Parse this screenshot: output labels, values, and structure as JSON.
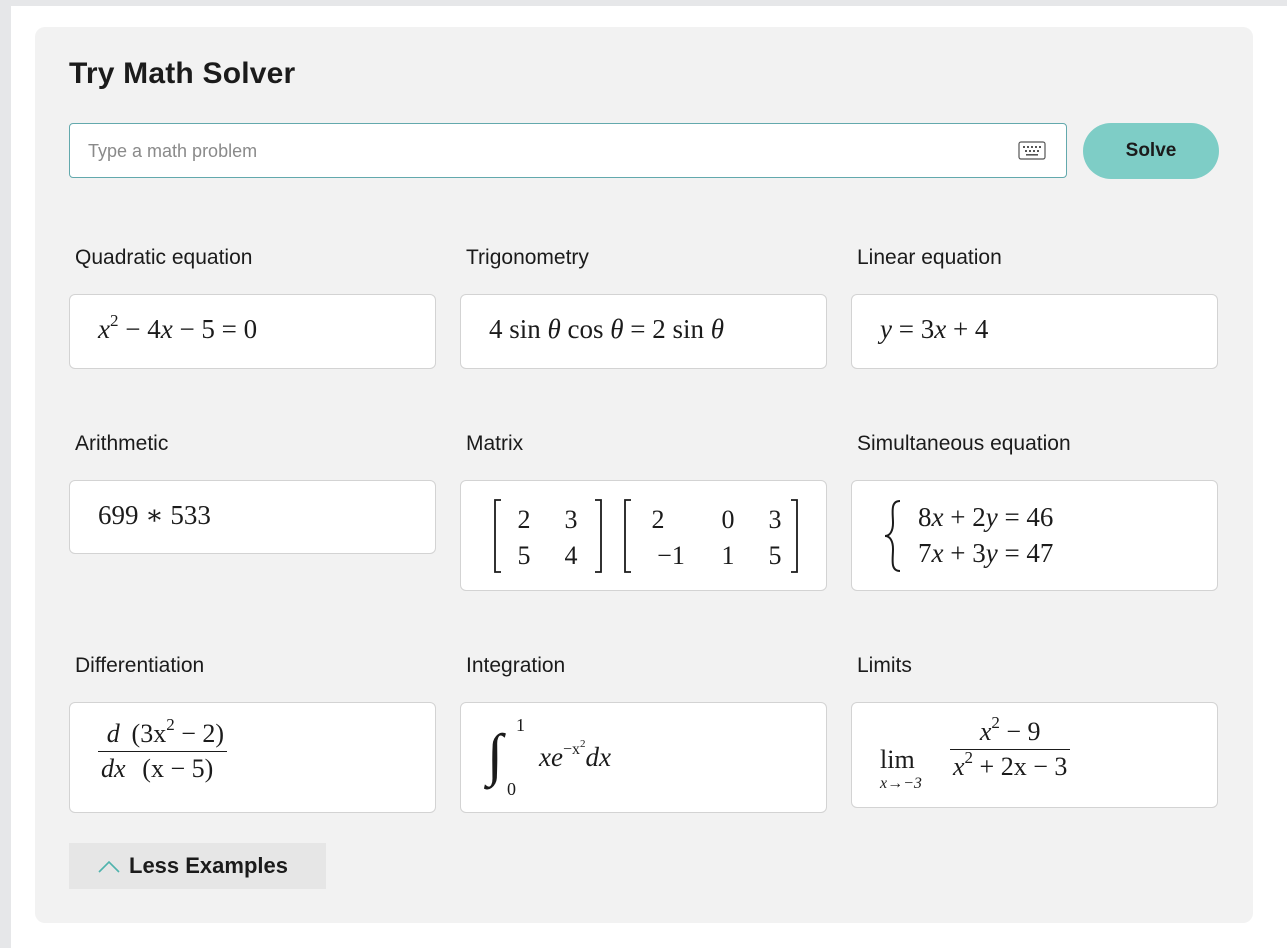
{
  "title": "Try Math Solver",
  "search": {
    "placeholder": "Type a math problem",
    "value": ""
  },
  "solve_label": "Solve",
  "accent_color": "#7ecdc6",
  "examples": [
    {
      "label": "Quadratic equation",
      "expression": "x^2 − 4x − 5 = 0"
    },
    {
      "label": "Trigonometry",
      "expression": "4 sin θ cos θ = 2 sin θ"
    },
    {
      "label": "Linear equation",
      "expression": "y = 3x + 4"
    },
    {
      "label": "Arithmetic",
      "expression": "699 ∗ 533"
    },
    {
      "label": "Matrix",
      "expression": "[2 3; 5 4][2 0 3; −1 1 5]"
    },
    {
      "label": "Simultaneous equation",
      "expression": "{8x + 2y = 46, 7x + 3y = 47}"
    },
    {
      "label": "Differentiation",
      "expression": "d/dx (3x^2 − 2)/(x − 5)"
    },
    {
      "label": "Integration",
      "expression": "∫_0^1 x e^(−x^2) dx"
    },
    {
      "label": "Limits",
      "expression": "lim_(x→−3) (x^2 − 9)/(x^2 + 2x − 3)"
    }
  ],
  "math_text": {
    "quadratic": {
      "x": "x",
      "exp2": "2",
      "rest": " − 4",
      "x2": "x",
      "tail": " − 5 = 0"
    },
    "trig": {
      "pre": "4 sin ",
      "th1": "θ",
      "mid": " cos ",
      "th2": "θ",
      "mid2": " = 2 sin ",
      "th3": "θ"
    },
    "linear": {
      "y": "y",
      "mid": " = 3",
      "x": "x",
      "tail": " + 4"
    },
    "arith": "699 ∗ 533",
    "matrix_a": [
      [
        "2",
        "3"
      ],
      [
        "5",
        "4"
      ]
    ],
    "matrix_b": [
      [
        "2",
        "0",
        "3"
      ],
      [
        "−1",
        "1",
        "5"
      ]
    ],
    "sim": [
      {
        "a": "8",
        "v1": "x",
        "b": " + 2",
        "v2": "y",
        "c": " = 46"
      },
      {
        "a": "7",
        "v1": "x",
        "b": " + 3",
        "v2": "y",
        "c": " = 47"
      }
    ],
    "diff": {
      "d_num": "d",
      "d_den": "dx",
      "num": "(3x",
      "num_exp": "2",
      "num_tail": " − 2)",
      "den": "(x − 5)"
    },
    "integ": {
      "sign": "∫",
      "upper": "1",
      "lower": "0",
      "x": "x",
      "e": "e",
      "exp": "−x",
      "exp2": "2",
      "dx": "dx"
    },
    "limit": {
      "lim": "lim",
      "sub": "x→−3",
      "num": "x",
      "num_exp": "2",
      "num_tail": " − 9",
      "den": "x",
      "den_exp": "2",
      "den_tail": " + 2x − 3"
    }
  },
  "less_label": "Less Examples"
}
